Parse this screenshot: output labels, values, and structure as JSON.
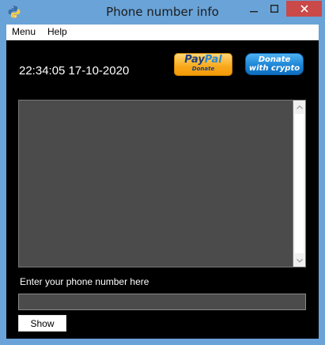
{
  "window": {
    "title": "Phone number info",
    "controls": {
      "minimize": "–",
      "maximize": "□",
      "close": "✕"
    }
  },
  "menubar": {
    "items": [
      "Menu",
      "Help"
    ]
  },
  "clock": {
    "text": "22:34:05 17-10-2020"
  },
  "donate": {
    "paypal": {
      "pay": "Pay",
      "pal": "Pal",
      "sub": "Donate"
    },
    "crypto": {
      "line1": "Donate",
      "line2": "with crypto"
    }
  },
  "prompt": {
    "text": "Enter your phone number here"
  },
  "phone_input": {
    "value": "",
    "placeholder": ""
  },
  "show_button": {
    "label": "Show"
  },
  "icons": {
    "app": "python-icon",
    "scroll_up": "chevron-up-icon",
    "scroll_down": "chevron-down-icon"
  },
  "colors": {
    "client_bg": "#000000",
    "frame": "#6aa3d8",
    "close": "#c94a48",
    "output_bg": "#4b4b4b"
  }
}
